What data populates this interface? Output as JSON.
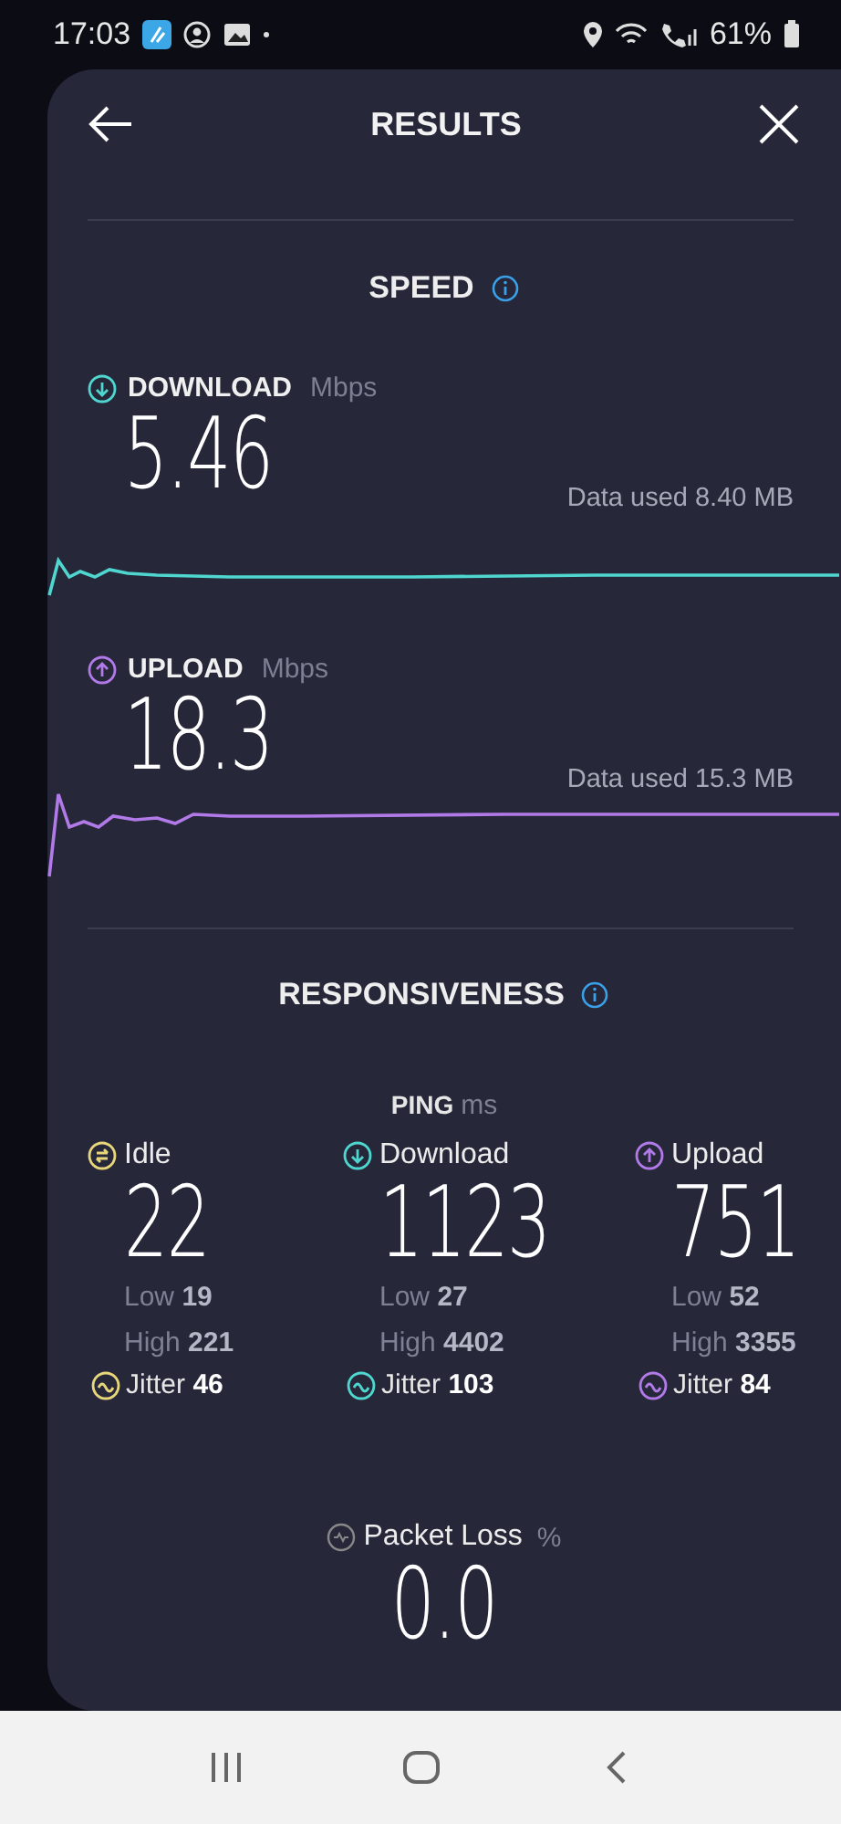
{
  "status_bar": {
    "time": "17:03",
    "battery": "61%"
  },
  "header": {
    "title": "RESULTS"
  },
  "speed": {
    "title": "SPEED",
    "items": [
      {
        "kind": "download",
        "label": "DOWNLOAD",
        "unit": "Mbps",
        "value": "5.46",
        "data_used": "Data used 8.40 MB",
        "color": "#4fd6cf"
      },
      {
        "kind": "upload",
        "label": "UPLOAD",
        "unit": "Mbps",
        "value": "18.3",
        "data_used": "Data used 15.3 MB",
        "color": "#b27ae8"
      }
    ]
  },
  "responsiveness": {
    "title": "RESPONSIVENESS",
    "ping_label": "PING",
    "ping_unit": "ms",
    "columns": [
      {
        "kind": "idle",
        "label": "Idle",
        "value": "22",
        "low_label": "Low",
        "low": "19",
        "high_label": "High",
        "high": "221",
        "jitter_label": "Jitter",
        "jitter": "46",
        "color": "#e8d77a"
      },
      {
        "kind": "download",
        "label": "Download",
        "value": "1123",
        "low_label": "Low",
        "low": "27",
        "high_label": "High",
        "high": "4402",
        "jitter_label": "Jitter",
        "jitter": "103",
        "color": "#4fd6cf"
      },
      {
        "kind": "upload",
        "label": "Upload",
        "value": "751",
        "low_label": "Low",
        "low": "52",
        "high_label": "High",
        "high": "3355",
        "jitter_label": "Jitter",
        "jitter": "84",
        "color": "#b27ae8"
      }
    ],
    "packet_loss": {
      "label": "Packet Loss",
      "unit": "%",
      "value": "0.0"
    }
  }
}
